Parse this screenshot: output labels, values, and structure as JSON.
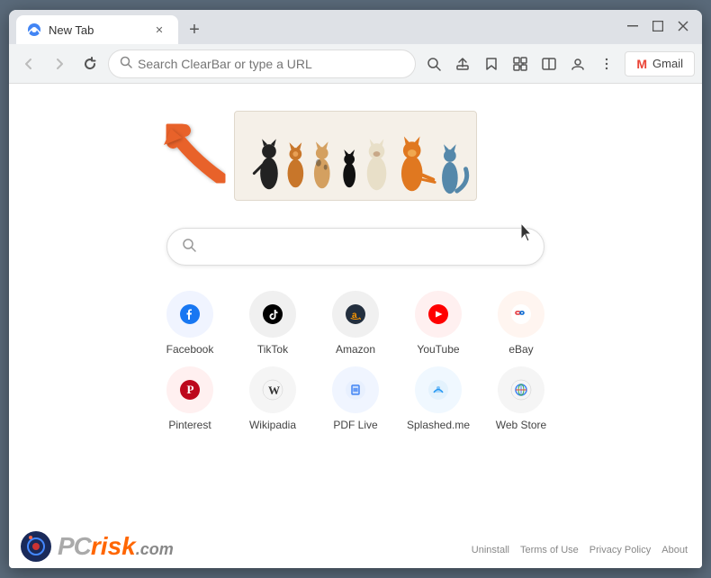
{
  "browser": {
    "tab_title": "New Tab",
    "tab_new_label": "+",
    "window_controls": {
      "minimize": "─",
      "maximize": "□",
      "close": "✕"
    },
    "nav": {
      "back_label": "←",
      "forward_label": "→",
      "refresh_label": "↻",
      "address_placeholder": "Search ClearBar or type a URL",
      "search_icon": "🔍",
      "share_icon": "⬆",
      "bookmark_icon": "☆",
      "extensions_icon": "🧩",
      "split_icon": "⬜",
      "profile_icon": "👤",
      "menu_icon": "⋮"
    },
    "gmail_button": "Gmail",
    "gmail_icon": "M"
  },
  "main": {
    "search_placeholder": "",
    "shortcuts": [
      {
        "id": "facebook",
        "label": "Facebook",
        "icon": "f",
        "color": "#1877F2",
        "bg": "#f1f3f4"
      },
      {
        "id": "tiktok",
        "label": "TikTok",
        "icon": "♪",
        "color": "#000000",
        "bg": "#f1f3f4"
      },
      {
        "id": "amazon",
        "label": "Amazon",
        "icon": "a",
        "color": "#FF9900",
        "bg": "#f1f3f4"
      },
      {
        "id": "youtube",
        "label": "YouTube",
        "icon": "▶",
        "color": "#FF0000",
        "bg": "#f1f3f4"
      },
      {
        "id": "ebay",
        "label": "eBay",
        "icon": "e",
        "color": "#E53238",
        "bg": "#f1f3f4"
      },
      {
        "id": "pinterest",
        "label": "Pinterest",
        "icon": "P",
        "color": "#BD081C",
        "bg": "#f1f3f4"
      },
      {
        "id": "wikipedia",
        "label": "Wikipadia",
        "icon": "W",
        "color": "#333333",
        "bg": "#f1f3f4"
      },
      {
        "id": "pdflive",
        "label": "PDF Live",
        "icon": "📄",
        "color": "#0066CC",
        "bg": "#f1f3f4"
      },
      {
        "id": "splashed",
        "label": "Splashed.me",
        "icon": "💬",
        "color": "#007AFF",
        "bg": "#f1f3f4"
      },
      {
        "id": "webstore",
        "label": "Web Store",
        "icon": "🌐",
        "color": "#4285F4",
        "bg": "#f1f3f4"
      }
    ]
  },
  "footer": {
    "links": [
      "Uninstall",
      "Terms of Use",
      "Privacy Policy",
      "About"
    ],
    "logo_text_pc": "PC",
    "logo_text_risk": "risk",
    "logo_text_com": ".com"
  }
}
